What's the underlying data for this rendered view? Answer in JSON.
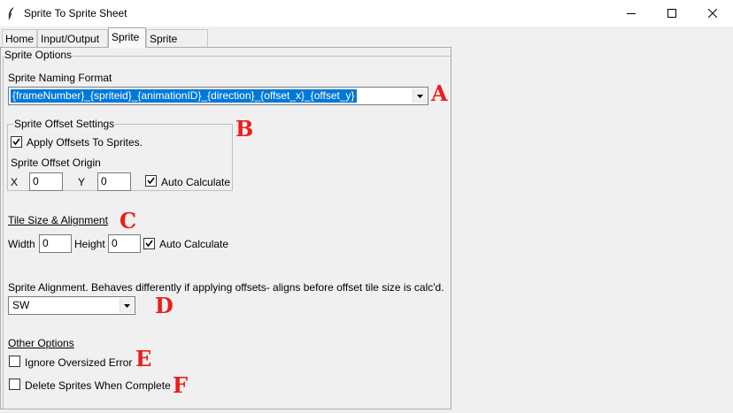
{
  "window": {
    "title": "Sprite To Sprite Sheet"
  },
  "tabs": [
    {
      "label": "Home"
    },
    {
      "label": "Input/Output"
    },
    {
      "label": "Sprite"
    },
    {
      "label": "Sprite Sheet"
    }
  ],
  "active_tab": "Sprite",
  "sprite_options": {
    "title": "Sprite Options",
    "naming_format": {
      "label": "Sprite Naming Format",
      "value": "{frameNumber}_{spriteid}_{animationID}_{direction}_{offset_x}_{offset_y}"
    },
    "offset_settings": {
      "title": "Sprite Offset Settings",
      "apply_offsets": {
        "label": "Apply Offsets To Sprites.",
        "checked": true
      },
      "origin_label": "Sprite Offset Origin",
      "x_label": "X",
      "x_value": "0",
      "y_label": "Y",
      "y_value": "0",
      "auto_calculate": {
        "label": "Auto Calculate",
        "checked": true
      }
    },
    "tile_size": {
      "title": "Tile Size & Alignment",
      "width_label": "Width",
      "width_value": "0",
      "height_label": "Height",
      "height_value": "0",
      "auto_calculate": {
        "label": "Auto Calculate",
        "checked": true
      }
    },
    "alignment": {
      "label": "Sprite Alignment. Behaves differently if applying offsets- aligns before offset tile size is calc'd.",
      "value": "SW"
    },
    "other_options": {
      "title": "Other Options",
      "ignore_oversized": {
        "label": "Ignore Oversized Error",
        "checked": false
      },
      "delete_sprites": {
        "label": "Delete Sprites When Complete",
        "checked": false
      }
    }
  },
  "annotations": [
    "A",
    "B",
    "C",
    "D",
    "E",
    "F"
  ],
  "colors": {
    "selection": "#0078d7",
    "annotation": "#ee1c1c"
  }
}
